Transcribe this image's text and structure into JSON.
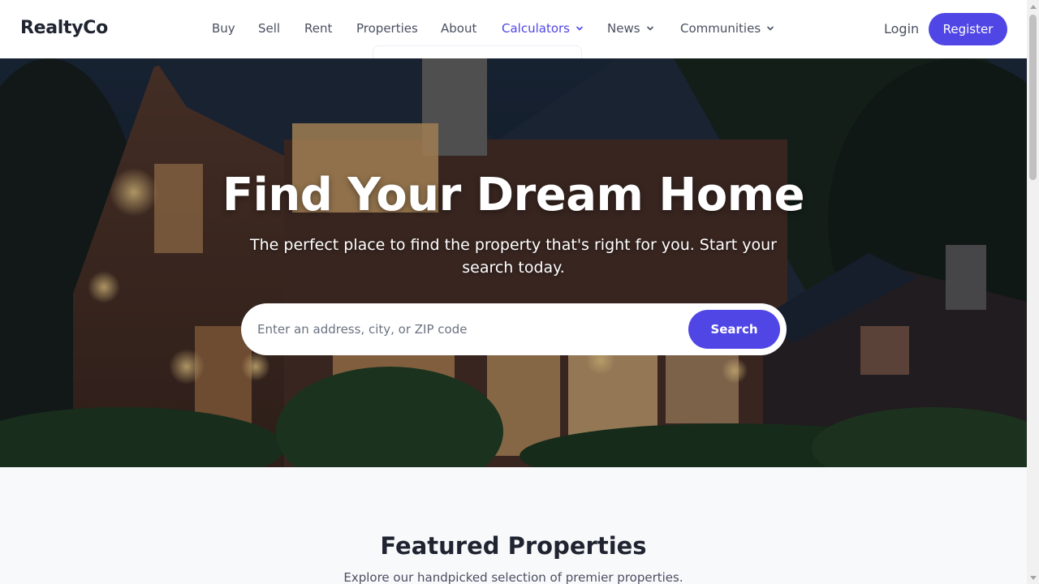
{
  "brand": {
    "name": "RealtyCo"
  },
  "nav": {
    "items": [
      {
        "label": "Buy",
        "has_dropdown": false,
        "active": false
      },
      {
        "label": "Sell",
        "has_dropdown": false,
        "active": false
      },
      {
        "label": "Rent",
        "has_dropdown": false,
        "active": false
      },
      {
        "label": "Properties",
        "has_dropdown": false,
        "active": false
      },
      {
        "label": "About",
        "has_dropdown": false,
        "active": false
      },
      {
        "label": "Calculators",
        "has_dropdown": true,
        "active": true
      },
      {
        "label": "News",
        "has_dropdown": true,
        "active": false
      },
      {
        "label": "Communities",
        "has_dropdown": true,
        "active": false
      }
    ],
    "login_label": "Login",
    "register_label": "Register"
  },
  "hero": {
    "title": "Find Your Dream Home",
    "subtitle": "The perfect place to find the property that's right for you. Start your search today.",
    "search_placeholder": "Enter an address, city, or ZIP code",
    "search_value": "",
    "search_button_label": "Search"
  },
  "featured": {
    "title": "Featured Properties",
    "subtitle": "Explore our handpicked selection of premier properties."
  },
  "colors": {
    "accent": "#4f46e5",
    "text_dark": "#1f2430",
    "text_muted": "#4a5061",
    "page_bg": "#f8f9fb"
  },
  "icons": {
    "dropdown": "chevron-down-icon"
  }
}
